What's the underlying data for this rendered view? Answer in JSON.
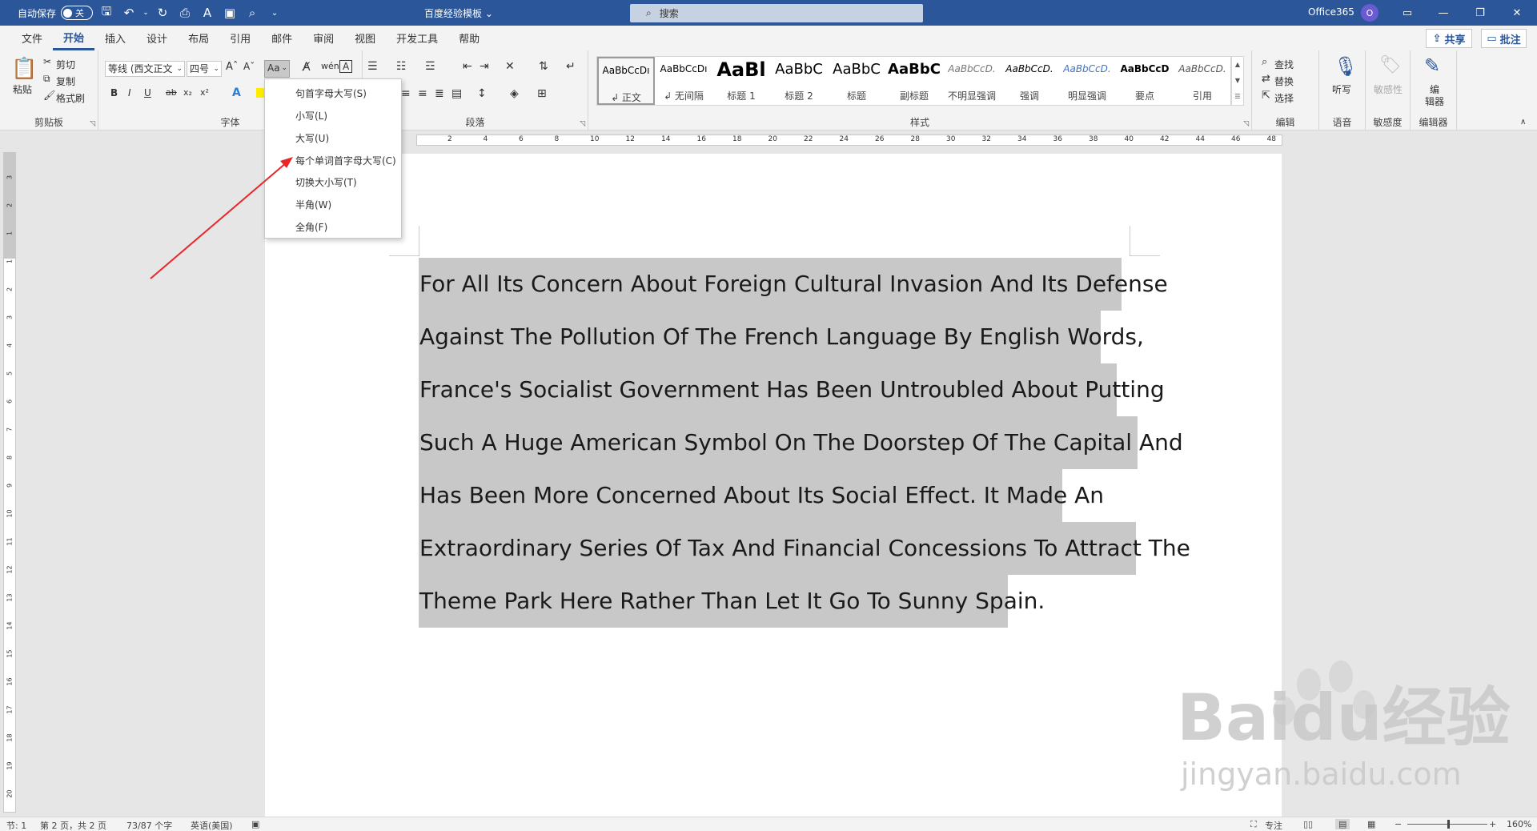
{
  "titlebar": {
    "autosave_label": "自动保存",
    "autosave_state": "关",
    "doc_title": "百度经验模板 ⌄",
    "search_placeholder": "搜索",
    "account": "Office365",
    "avatar_initial": "O"
  },
  "tabs": [
    "文件",
    "开始",
    "插入",
    "设计",
    "布局",
    "引用",
    "邮件",
    "审阅",
    "视图",
    "开发工具",
    "帮助"
  ],
  "active_tab": "开始",
  "share_label": "共享",
  "comment_label": "批注",
  "ribbon": {
    "clipboard": {
      "label": "剪贴板",
      "paste": "粘贴",
      "cut": "剪切",
      "copy": "复制",
      "format_painter": "格式刷"
    },
    "font": {
      "label": "字体",
      "font_name": "等线 (西文正文",
      "font_size": "四号",
      "case_button": "Aa"
    },
    "paragraph": {
      "label": "段落"
    },
    "styles": {
      "label": "样式",
      "items": [
        {
          "sample": "AaBbCcDı",
          "name": "↲ 正文"
        },
        {
          "sample": "AaBbCcDı",
          "name": "↲ 无间隔"
        },
        {
          "sample": "AaBl",
          "name": "标题 1"
        },
        {
          "sample": "AaBbC",
          "name": "标题 2"
        },
        {
          "sample": "AaBbC",
          "name": "标题"
        },
        {
          "sample": "AaBbC",
          "name": "副标题"
        },
        {
          "sample": "AaBbCcD.",
          "name": "不明显强调"
        },
        {
          "sample": "AaBbCcD.",
          "name": "强调"
        },
        {
          "sample": "AaBbCcD.",
          "name": "明显强调"
        },
        {
          "sample": "AaBbCcD",
          "name": "要点"
        },
        {
          "sample": "AaBbCcD.",
          "name": "引用"
        }
      ]
    },
    "editing": {
      "label": "编辑",
      "find": "查找",
      "replace": "替换",
      "select": "选择"
    },
    "voice": {
      "label": "语音",
      "dictate": "听写"
    },
    "sensitivity": {
      "label": "敏感度",
      "button": "敏感性"
    },
    "editor": {
      "label": "编辑器",
      "button_l1": "编",
      "button_l2": "辑器"
    }
  },
  "case_menu": [
    "句首字母大写(S)",
    "小写(L)",
    "大写(U)",
    "每个单词首字母大写(C)",
    "切换大小写(T)",
    "半角(W)",
    "全角(F)"
  ],
  "document": {
    "lines": [
      "For All Its Concern About Foreign Cultural Invasion And Its Defense",
      "Against The Pollution Of The French Language By English Words,",
      "France's Socialist Government Has Been Untroubled About Putting",
      "Such A Huge American Symbol On The Doorstep Of The Capital And",
      "Has Been More Concerned About Its Social Effect. It Made An",
      "Extraordinary Series Of Tax And Financial Concessions To Attract The",
      "Theme Park Here Rather Than Let It Go To Sunny Spain."
    ]
  },
  "ruler_numbers": [
    "2",
    "4",
    "6",
    "8",
    "10",
    "12",
    "14",
    "16",
    "18",
    "20",
    "22",
    "24",
    "26",
    "28",
    "30",
    "32",
    "34",
    "36",
    "38",
    "40",
    "42",
    "44",
    "46",
    "48"
  ],
  "vruler_numbers": [
    "3",
    "2",
    "1",
    "1",
    "2",
    "3",
    "4",
    "5",
    "6",
    "7",
    "8",
    "9",
    "10",
    "11",
    "12",
    "13",
    "14",
    "15",
    "16",
    "17",
    "18",
    "19",
    "20"
  ],
  "statusbar": {
    "section": "节: 1",
    "page": "第 2 页，共 2 页",
    "words": "73/87 个字",
    "language": "英语(美国)",
    "focus": "专注",
    "zoom": "160%"
  },
  "watermark": {
    "brand": "Baidu经验",
    "url": "jingyan.baidu.com"
  },
  "colors": {
    "accent": "#2b579a",
    "selection": "#c8c8c8",
    "arrow": "#e8262a"
  }
}
